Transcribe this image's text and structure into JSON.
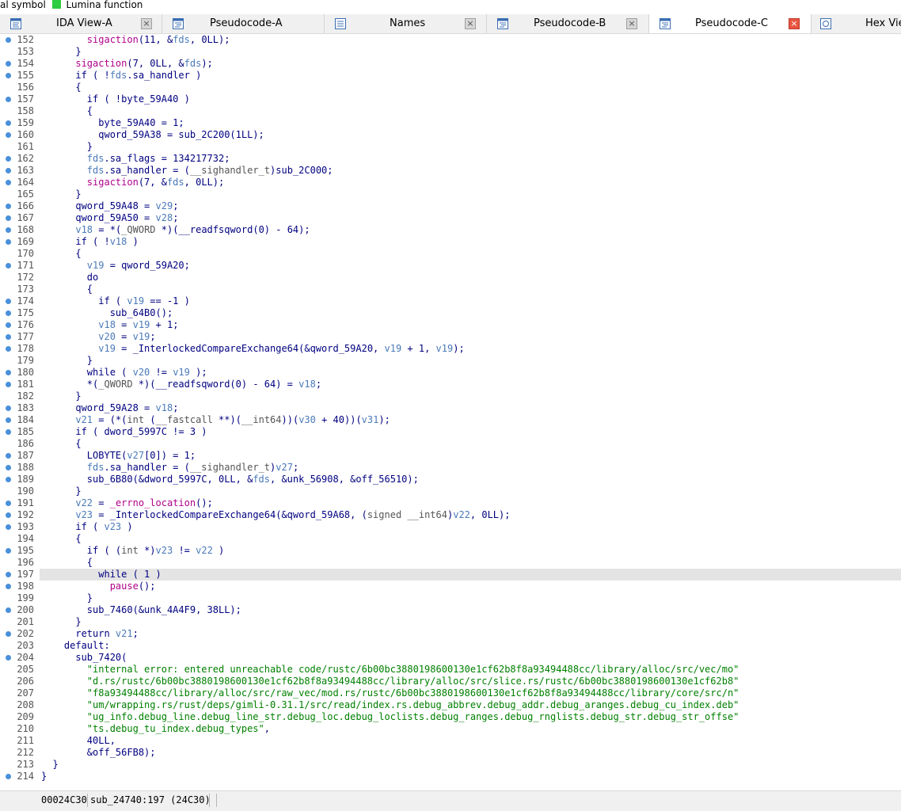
{
  "legend": {
    "items": [
      {
        "label": "al symbol",
        "color": ""
      },
      {
        "label": "Lumina function",
        "color": "#2ecc40"
      }
    ]
  },
  "tabs": [
    {
      "label": "IDA View-A",
      "icon": "disassembly-view-icon",
      "active": false
    },
    {
      "label": "Pseudocode-A",
      "icon": "pseudocode-icon",
      "active": false
    },
    {
      "label": "Names",
      "icon": "names-list-icon",
      "active": false
    },
    {
      "label": "Pseudocode-B",
      "icon": "pseudocode-icon",
      "active": false
    },
    {
      "label": "Pseudocode-C",
      "icon": "pseudocode-icon",
      "active": true
    },
    {
      "label": "Hex Vie",
      "icon": "hex-view-icon",
      "active": false
    }
  ],
  "code_lines": [
    {
      "num": "152",
      "dot": true,
      "segs": [
        [
          "        ",
          ""
        ],
        [
          "sigaction",
          "f"
        ],
        [
          "(11, &",
          ""
        ],
        [
          "fds",
          "v"
        ],
        [
          ", 0LL);",
          ""
        ]
      ]
    },
    {
      "num": "153",
      "dot": false,
      "segs": [
        [
          "      }",
          ""
        ]
      ]
    },
    {
      "num": "154",
      "dot": true,
      "segs": [
        [
          "      ",
          ""
        ],
        [
          "sigaction",
          "f"
        ],
        [
          "(7, 0LL, &",
          ""
        ],
        [
          "fds",
          "v"
        ],
        [
          ");",
          ""
        ]
      ]
    },
    {
      "num": "155",
      "dot": true,
      "segs": [
        [
          "      if ( !",
          ""
        ],
        [
          "fds",
          "v"
        ],
        [
          ".sa_handler )",
          ""
        ]
      ]
    },
    {
      "num": "156",
      "dot": false,
      "segs": [
        [
          "      {",
          ""
        ]
      ]
    },
    {
      "num": "157",
      "dot": true,
      "segs": [
        [
          "        if ( !byte_59A40 )",
          ""
        ]
      ]
    },
    {
      "num": "158",
      "dot": false,
      "segs": [
        [
          "        {",
          ""
        ]
      ]
    },
    {
      "num": "159",
      "dot": true,
      "segs": [
        [
          "          byte_59A40 = 1;",
          ""
        ]
      ]
    },
    {
      "num": "160",
      "dot": true,
      "segs": [
        [
          "          qword_59A38 = sub_2C200(1LL);",
          ""
        ]
      ]
    },
    {
      "num": "161",
      "dot": false,
      "segs": [
        [
          "        }",
          ""
        ]
      ]
    },
    {
      "num": "162",
      "dot": true,
      "segs": [
        [
          "        ",
          ""
        ],
        [
          "fds",
          "v"
        ],
        [
          ".sa_flags = 134217732;",
          ""
        ]
      ]
    },
    {
      "num": "163",
      "dot": true,
      "segs": [
        [
          "        ",
          ""
        ],
        [
          "fds",
          "v"
        ],
        [
          ".sa_handler = (",
          ""
        ],
        [
          "__sighandler_t",
          "g"
        ],
        [
          ")sub_2C000;",
          ""
        ]
      ]
    },
    {
      "num": "164",
      "dot": true,
      "segs": [
        [
          "        ",
          ""
        ],
        [
          "sigaction",
          "f"
        ],
        [
          "(7, &",
          ""
        ],
        [
          "fds",
          "v"
        ],
        [
          ", 0LL);",
          ""
        ]
      ]
    },
    {
      "num": "165",
      "dot": false,
      "segs": [
        [
          "      }",
          ""
        ]
      ]
    },
    {
      "num": "166",
      "dot": true,
      "segs": [
        [
          "      qword_59A48 = ",
          ""
        ],
        [
          "v29",
          "v"
        ],
        [
          ";",
          ""
        ]
      ]
    },
    {
      "num": "167",
      "dot": true,
      "segs": [
        [
          "      qword_59A50 = ",
          ""
        ],
        [
          "v28",
          "v"
        ],
        [
          ";",
          ""
        ]
      ]
    },
    {
      "num": "168",
      "dot": true,
      "segs": [
        [
          "      ",
          ""
        ],
        [
          "v18",
          "v"
        ],
        [
          " = *(",
          ""
        ],
        [
          "_QWORD",
          "g"
        ],
        [
          " *)(__readfsqword(0) - 64);",
          ""
        ]
      ]
    },
    {
      "num": "169",
      "dot": true,
      "segs": [
        [
          "      if ( !",
          ""
        ],
        [
          "v18",
          "v"
        ],
        [
          " )",
          ""
        ]
      ]
    },
    {
      "num": "170",
      "dot": false,
      "segs": [
        [
          "      {",
          ""
        ]
      ]
    },
    {
      "num": "171",
      "dot": true,
      "segs": [
        [
          "        ",
          ""
        ],
        [
          "v19",
          "v"
        ],
        [
          " = qword_59A20;",
          ""
        ]
      ]
    },
    {
      "num": "172",
      "dot": false,
      "segs": [
        [
          "        do",
          ""
        ]
      ]
    },
    {
      "num": "173",
      "dot": false,
      "segs": [
        [
          "        {",
          ""
        ]
      ]
    },
    {
      "num": "174",
      "dot": true,
      "segs": [
        [
          "          if ( ",
          ""
        ],
        [
          "v19",
          "v"
        ],
        [
          " == -1 )",
          ""
        ]
      ]
    },
    {
      "num": "175",
      "dot": true,
      "segs": [
        [
          "            sub_64B0();",
          ""
        ]
      ]
    },
    {
      "num": "176",
      "dot": true,
      "segs": [
        [
          "          ",
          ""
        ],
        [
          "v18",
          "v"
        ],
        [
          " = ",
          ""
        ],
        [
          "v19",
          "v"
        ],
        [
          " + 1;",
          ""
        ]
      ]
    },
    {
      "num": "177",
      "dot": true,
      "segs": [
        [
          "          ",
          ""
        ],
        [
          "v20",
          "v"
        ],
        [
          " = ",
          ""
        ],
        [
          "v19",
          "v"
        ],
        [
          ";",
          ""
        ]
      ]
    },
    {
      "num": "178",
      "dot": true,
      "segs": [
        [
          "          ",
          ""
        ],
        [
          "v19",
          "v"
        ],
        [
          " = _InterlockedCompareExchange64(&qword_59A20, ",
          ""
        ],
        [
          "v19",
          "v"
        ],
        [
          " + 1, ",
          ""
        ],
        [
          "v19",
          "v"
        ],
        [
          ");",
          ""
        ]
      ]
    },
    {
      "num": "179",
      "dot": false,
      "segs": [
        [
          "        }",
          ""
        ]
      ]
    },
    {
      "num": "180",
      "dot": true,
      "segs": [
        [
          "        while ( ",
          ""
        ],
        [
          "v20",
          "v"
        ],
        [
          " != ",
          ""
        ],
        [
          "v19",
          "v"
        ],
        [
          " );",
          ""
        ]
      ]
    },
    {
      "num": "181",
      "dot": true,
      "segs": [
        [
          "        *(",
          ""
        ],
        [
          "_QWORD",
          "g"
        ],
        [
          " *)(__readfsqword(0) - 64) = ",
          ""
        ],
        [
          "v18",
          "v"
        ],
        [
          ";",
          ""
        ]
      ]
    },
    {
      "num": "182",
      "dot": false,
      "segs": [
        [
          "      }",
          ""
        ]
      ]
    },
    {
      "num": "183",
      "dot": true,
      "segs": [
        [
          "      qword_59A28 = ",
          ""
        ],
        [
          "v18",
          "v"
        ],
        [
          ";",
          ""
        ]
      ]
    },
    {
      "num": "184",
      "dot": true,
      "segs": [
        [
          "      ",
          ""
        ],
        [
          "v21",
          "v"
        ],
        [
          " = (*(",
          ""
        ],
        [
          "int",
          "g"
        ],
        [
          " (",
          ""
        ],
        [
          "__fastcall",
          "g"
        ],
        [
          " **)(",
          ""
        ],
        [
          "__int64",
          "g"
        ],
        [
          "))(",
          ""
        ],
        [
          "v30",
          "v"
        ],
        [
          " + 40))(",
          ""
        ],
        [
          "v31",
          "v"
        ],
        [
          ");",
          ""
        ]
      ]
    },
    {
      "num": "185",
      "dot": true,
      "segs": [
        [
          "      if ( dword_5997C != 3 )",
          ""
        ]
      ]
    },
    {
      "num": "186",
      "dot": false,
      "segs": [
        [
          "      {",
          ""
        ]
      ]
    },
    {
      "num": "187",
      "dot": true,
      "segs": [
        [
          "        LOBYTE(",
          ""
        ],
        [
          "v27",
          "v"
        ],
        [
          "[0]) = 1;",
          ""
        ]
      ]
    },
    {
      "num": "188",
      "dot": true,
      "segs": [
        [
          "        ",
          ""
        ],
        [
          "fds",
          "v"
        ],
        [
          ".sa_handler = (",
          ""
        ],
        [
          "__sighandler_t",
          "g"
        ],
        [
          ")",
          ""
        ],
        [
          "v27",
          "v"
        ],
        [
          ";",
          ""
        ]
      ]
    },
    {
      "num": "189",
      "dot": true,
      "segs": [
        [
          "        sub_6B80(&dword_5997C, 0LL, &",
          ""
        ],
        [
          "fds",
          "v"
        ],
        [
          ", &unk_56908, &off_56510);",
          ""
        ]
      ]
    },
    {
      "num": "190",
      "dot": false,
      "segs": [
        [
          "      }",
          ""
        ]
      ]
    },
    {
      "num": "191",
      "dot": true,
      "segs": [
        [
          "      ",
          ""
        ],
        [
          "v22",
          "v"
        ],
        [
          " = ",
          ""
        ],
        [
          "_errno_location",
          "f"
        ],
        [
          "();",
          ""
        ]
      ]
    },
    {
      "num": "192",
      "dot": true,
      "segs": [
        [
          "      ",
          ""
        ],
        [
          "v23",
          "v"
        ],
        [
          " = _InterlockedCompareExchange64(&qword_59A68, (",
          ""
        ],
        [
          "signed __int64",
          "g"
        ],
        [
          ")",
          ""
        ],
        [
          "v22",
          "v"
        ],
        [
          ", 0LL);",
          ""
        ]
      ]
    },
    {
      "num": "193",
      "dot": true,
      "segs": [
        [
          "      if ( ",
          ""
        ],
        [
          "v23",
          "v"
        ],
        [
          " )",
          ""
        ]
      ]
    },
    {
      "num": "194",
      "dot": false,
      "segs": [
        [
          "      {",
          ""
        ]
      ]
    },
    {
      "num": "195",
      "dot": true,
      "segs": [
        [
          "        if ( (",
          ""
        ],
        [
          "int",
          "g"
        ],
        [
          " *)",
          ""
        ],
        [
          "v23",
          "v"
        ],
        [
          " != ",
          ""
        ],
        [
          "v22",
          "v"
        ],
        [
          " )",
          ""
        ]
      ]
    },
    {
      "num": "196",
      "dot": false,
      "segs": [
        [
          "        {",
          ""
        ]
      ]
    },
    {
      "num": "197",
      "dot": true,
      "hl": true,
      "segs": [
        [
          "          while ( 1 )",
          ""
        ]
      ]
    },
    {
      "num": "198",
      "dot": true,
      "segs": [
        [
          "            ",
          ""
        ],
        [
          "pause",
          "f"
        ],
        [
          "();",
          ""
        ]
      ]
    },
    {
      "num": "199",
      "dot": false,
      "segs": [
        [
          "        }",
          ""
        ]
      ]
    },
    {
      "num": "200",
      "dot": true,
      "segs": [
        [
          "        sub_7460(&unk_4A4F9, 38LL);",
          ""
        ]
      ]
    },
    {
      "num": "201",
      "dot": false,
      "segs": [
        [
          "      }",
          ""
        ]
      ]
    },
    {
      "num": "202",
      "dot": true,
      "segs": [
        [
          "      return ",
          ""
        ],
        [
          "v21",
          "v"
        ],
        [
          ";",
          ""
        ]
      ]
    },
    {
      "num": "203",
      "dot": false,
      "segs": [
        [
          "    default:",
          ""
        ]
      ]
    },
    {
      "num": "204",
      "dot": true,
      "segs": [
        [
          "      sub_7420(",
          ""
        ]
      ]
    },
    {
      "num": "205",
      "dot": false,
      "segs": [
        [
          "        ",
          ""
        ],
        [
          "\"internal error: entered unreachable code/rustc/6b00bc3880198600130e1cf62b8f8a93494488cc/library/alloc/src/vec/mo\"",
          "s"
        ]
      ]
    },
    {
      "num": "206",
      "dot": false,
      "segs": [
        [
          "        ",
          ""
        ],
        [
          "\"d.rs/rustc/6b00bc3880198600130e1cf62b8f8a93494488cc/library/alloc/src/slice.rs/rustc/6b00bc3880198600130e1cf62b8\"",
          "s"
        ]
      ]
    },
    {
      "num": "207",
      "dot": false,
      "segs": [
        [
          "        ",
          ""
        ],
        [
          "\"f8a93494488cc/library/alloc/src/raw_vec/mod.rs/rustc/6b00bc3880198600130e1cf62b8f8a93494488cc/library/core/src/n\"",
          "s"
        ]
      ]
    },
    {
      "num": "208",
      "dot": false,
      "segs": [
        [
          "        ",
          ""
        ],
        [
          "\"um/wrapping.rs/rust/deps/gimli-0.31.1/src/read/index.rs.debug_abbrev.debug_addr.debug_aranges.debug_cu_index.deb\"",
          "s"
        ]
      ]
    },
    {
      "num": "209",
      "dot": false,
      "segs": [
        [
          "        ",
          ""
        ],
        [
          "\"ug_info.debug_line.debug_line_str.debug_loc.debug_loclists.debug_ranges.debug_rnglists.debug_str.debug_str_offse\"",
          "s"
        ]
      ]
    },
    {
      "num": "210",
      "dot": false,
      "segs": [
        [
          "        ",
          ""
        ],
        [
          "\"ts.debug_tu_index.debug_types\"",
          "s"
        ],
        [
          ",",
          ""
        ]
      ]
    },
    {
      "num": "211",
      "dot": false,
      "segs": [
        [
          "        40LL,",
          ""
        ]
      ]
    },
    {
      "num": "212",
      "dot": false,
      "segs": [
        [
          "        &off_56FB8);",
          ""
        ]
      ]
    },
    {
      "num": "213",
      "dot": false,
      "segs": [
        [
          "  }",
          ""
        ]
      ]
    },
    {
      "num": "214",
      "dot": true,
      "segs": [
        [
          "}",
          ""
        ]
      ]
    }
  ],
  "statusbar": {
    "address": "00024C30",
    "location": "sub_24740:197 (24C30)"
  },
  "colors": {
    "breakpoint_dot": "#4a90d9",
    "keyword_text": "#000080",
    "variable": "#4a7ab8",
    "function": "#b0008b",
    "string": "#008000",
    "type": "#555555",
    "active_tab_close": "#e8553f"
  }
}
